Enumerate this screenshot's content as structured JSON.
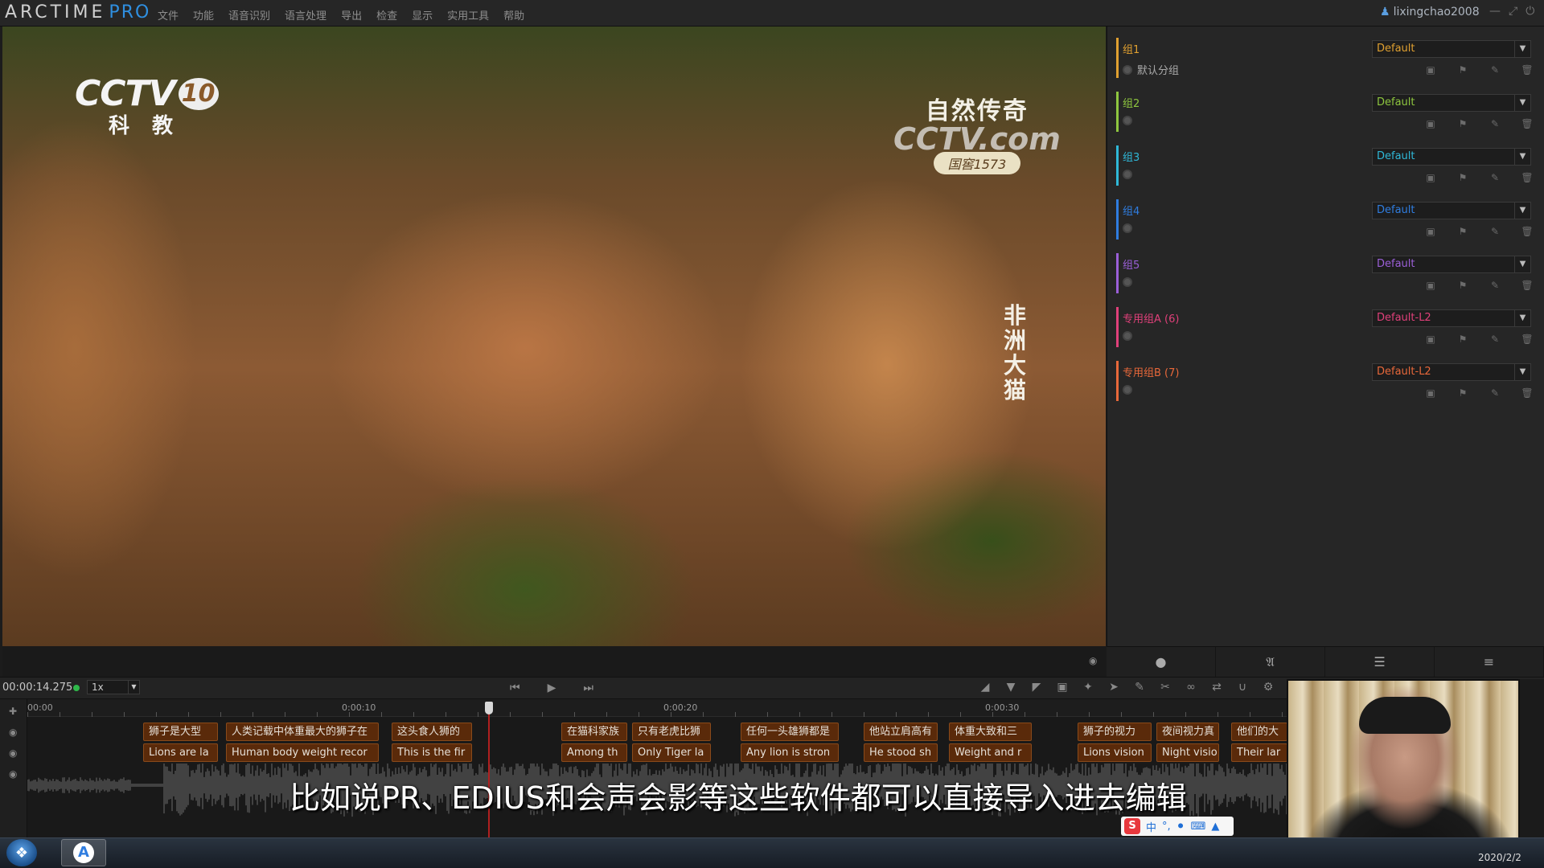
{
  "app": {
    "logo_main": "ARCTIME",
    "logo_pro": "PRO",
    "menu": [
      "文件",
      "功能",
      "语音识别",
      "语言处理",
      "导出",
      "检查",
      "显示",
      "实用工具",
      "帮助"
    ],
    "user": "lixingchao2008"
  },
  "video": {
    "cctv_main": "CCTV",
    "cctv_num": "10",
    "cctv_sub": "科教",
    "nature_title": "自然传奇",
    "nature_watermark": "CCTV.com",
    "nature_badge": "国窖1573",
    "side_title": "非洲大猫"
  },
  "groups": [
    {
      "name": "组1",
      "color": "#e0a030",
      "style": "Default",
      "sub": "默认分组"
    },
    {
      "name": "组2",
      "color": "#8ec63f",
      "style": "Default",
      "sub": ""
    },
    {
      "name": "组3",
      "color": "#2fb8d8",
      "style": "Default",
      "sub": ""
    },
    {
      "name": "组4",
      "color": "#2f7de0",
      "style": "Default",
      "sub": ""
    },
    {
      "name": "组5",
      "color": "#9b5fd8",
      "style": "Default",
      "sub": ""
    },
    {
      "name": "专用组A (6)",
      "color": "#e0407a",
      "style": "Default-L2",
      "sub": ""
    },
    {
      "name": "专用组B (7)",
      "color": "#e8683a",
      "style": "Default-L2",
      "sub": ""
    }
  ],
  "transport": {
    "timecode": "00:00:14.275",
    "speed": "1x"
  },
  "ruler": [
    "00:00",
    "0:00:10",
    "0:00:20",
    "0:00:30"
  ],
  "clips_zh": [
    "狮子是大型",
    "人类记载中体重最大的狮子在",
    "这头食人狮的",
    "在猫科家族",
    "只有老虎比狮",
    "任何一头雄狮都是",
    "他站立肩高有",
    "体重大致和三",
    "狮子的视力",
    "夜间视力真",
    "他们的大"
  ],
  "clips_en": [
    "Lions are la",
    "Human body weight recor",
    "This is the fir",
    "Among th",
    "Only Tiger la",
    "Any lion is stron",
    "He stood sh",
    "Weight and r",
    "Lions vision",
    "Night visio",
    "Their lar"
  ],
  "subtitle": "比如说PR、EDIUS和会声会影等这些软件都可以直接导入进去编辑",
  "ime": {
    "lang": "中"
  },
  "clock": "2020/2/2"
}
